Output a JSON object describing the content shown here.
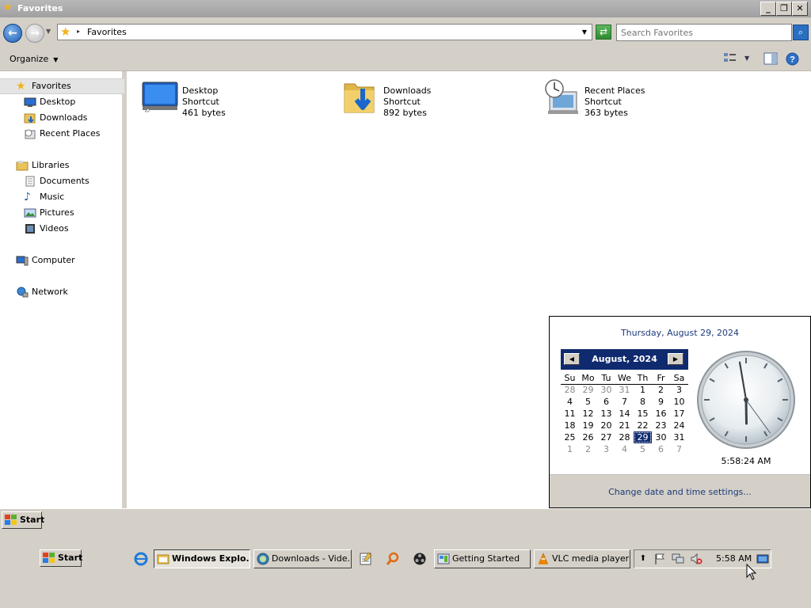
{
  "window": {
    "title": "Favorites",
    "buttons": [
      "_",
      "❐",
      "✕"
    ]
  },
  "address": {
    "separator": "▸",
    "path": "Favorites",
    "search_placeholder": "Search Favorites"
  },
  "toolbar": {
    "organize_label": "Organize",
    "icons": [
      "views-icon",
      "preview-pane-icon",
      "help-icon"
    ]
  },
  "sidebar": {
    "favorites": {
      "label": "Favorites",
      "items": [
        {
          "label": "Desktop",
          "icon": "desktop-icon"
        },
        {
          "label": "Downloads",
          "icon": "downloads-icon"
        },
        {
          "label": "Recent Places",
          "icon": "recent-places-icon"
        }
      ]
    },
    "libraries": {
      "label": "Libraries",
      "items": [
        {
          "label": "Documents",
          "icon": "documents-icon"
        },
        {
          "label": "Music",
          "icon": "music-icon"
        },
        {
          "label": "Pictures",
          "icon": "pictures-icon"
        },
        {
          "label": "Videos",
          "icon": "videos-icon"
        }
      ]
    },
    "computer": {
      "label": "Computer"
    },
    "network": {
      "label": "Network"
    }
  },
  "files": [
    {
      "name": "Desktop",
      "type": "Shortcut",
      "size": "461 bytes",
      "icon": "desktop-icon"
    },
    {
      "name": "Downloads",
      "type": "Shortcut",
      "size": "892 bytes",
      "icon": "downloads-folder-icon"
    },
    {
      "name": "Recent Places",
      "type": "Shortcut",
      "size": "363 bytes",
      "icon": "recent-places-icon"
    }
  ],
  "flyout": {
    "long_date": "Thursday, August 29, 2024",
    "month_title": "August, 2024",
    "weekdays": [
      "Su",
      "Mo",
      "Tu",
      "We",
      "Th",
      "Fr",
      "Sa"
    ],
    "weeks": [
      [
        "28",
        "29",
        "30",
        "31",
        "1",
        "2",
        "3"
      ],
      [
        "4",
        "5",
        "6",
        "7",
        "8",
        "9",
        "10"
      ],
      [
        "11",
        "12",
        "13",
        "14",
        "15",
        "16",
        "17"
      ],
      [
        "18",
        "19",
        "20",
        "21",
        "22",
        "23",
        "24"
      ],
      [
        "25",
        "26",
        "27",
        "28",
        "29",
        "30",
        "31"
      ],
      [
        "1",
        "2",
        "3",
        "4",
        "5",
        "6",
        "7"
      ]
    ],
    "selected_day": "29",
    "clock_time": "5:58:24 AM",
    "change_link": "Change date and time settings...",
    "prev_arrow": "◀",
    "next_arrow": "▶"
  },
  "start": {
    "label": "Start"
  },
  "taskbar": {
    "start_label": "Start",
    "quicklaunch": [
      "internet-explorer-icon"
    ],
    "buttons": [
      {
        "label": "Windows Explo...",
        "active": true,
        "icon": "explorer-folder-icon"
      },
      {
        "label": "Downloads - Vide...",
        "active": false,
        "icon": "media-icon"
      }
    ],
    "extra_icons": [
      "notepad-icon",
      "search-magnifier-icon",
      "obs-icon"
    ],
    "buttons2": [
      {
        "label": "Getting Started",
        "icon": "getting-started-icon"
      },
      {
        "label": "VLC media player",
        "icon": "vlc-icon"
      }
    ],
    "tray": {
      "time": "5:58 AM",
      "icons": [
        "show-hidden-icon",
        "action-center-flag-icon",
        "network-icon",
        "volume-muted-icon",
        "show-desktop-icon"
      ]
    }
  },
  "colors": {
    "accent_dark_blue": "#0f2a6e",
    "link_blue": "#1c3a7a",
    "chrome_gray": "#d4d0c8"
  }
}
